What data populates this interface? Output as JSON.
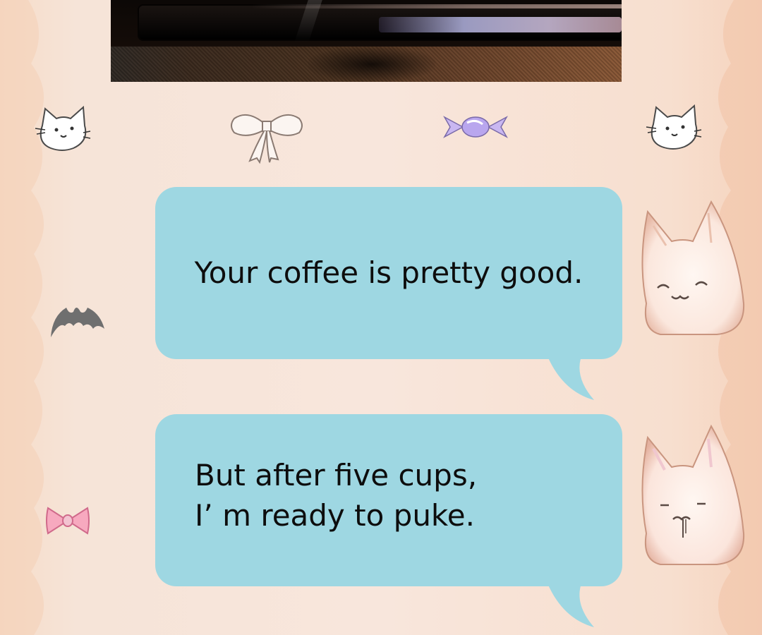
{
  "messages": [
    {
      "text": "Your coffee is pretty good."
    },
    {
      "text": "But after five cups,\nI’   m ready to puke."
    }
  ],
  "colors": {
    "bubble": "#9ed7e2",
    "background": "#f8e6dc",
    "text": "#0d0d0d"
  },
  "icons": [
    "cat-face-icon",
    "ribbon-bow-icon",
    "candy-icon",
    "bat-icon",
    "pink-bow-icon",
    "cat-avatar-icon"
  ]
}
